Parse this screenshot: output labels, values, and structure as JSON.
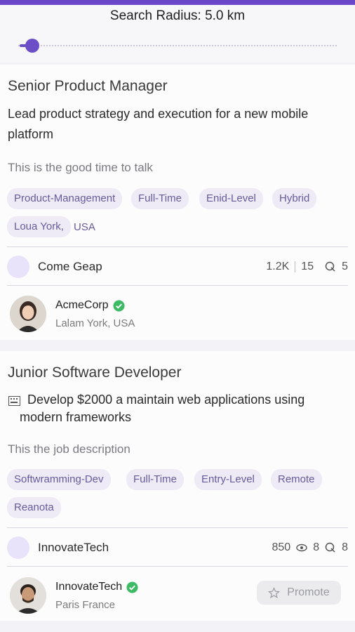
{
  "search": {
    "radius_label": "Search Radius: 5.0 km",
    "radius_value_km": 5.0,
    "slider_fraction": 0.03
  },
  "jobs": [
    {
      "title": "Senior Product Manager",
      "description": "Lead product strategy and execution for a new mobile platform",
      "subtitle": "This is the good time to talk",
      "tags": [
        "Product-Management",
        "Full-Time",
        "Enid-Level",
        "Hybrid"
      ],
      "location_tag": "Loua York,",
      "location_suffix": "USA",
      "company": "Come Geap",
      "stats": {
        "views": "1.2K",
        "likes": "15",
        "applies": "5"
      },
      "poster": {
        "name": "AcmeCorp",
        "location": "Lalam York, USA",
        "verified": true
      }
    },
    {
      "title": "Junior Software Developer",
      "description": "Develop $2000 a maintain web applications using modern frameworks",
      "subtitle": "This the job description",
      "tags": [
        "Softwramming-Dev",
        "Full-Time",
        "Entry-Level",
        "Remote"
      ],
      "location_tag": "Reanota",
      "company": "InnovateTech",
      "stats": {
        "views": "850",
        "likes": "8",
        "applies": "8"
      },
      "poster": {
        "name": "InnovateTech",
        "location": "Paris France",
        "verified": true
      },
      "promote_label": "Promote"
    }
  ],
  "colors": {
    "accent": "#6a46c8",
    "tag_bg": "#eeebf7",
    "verified": "#3cba64"
  }
}
